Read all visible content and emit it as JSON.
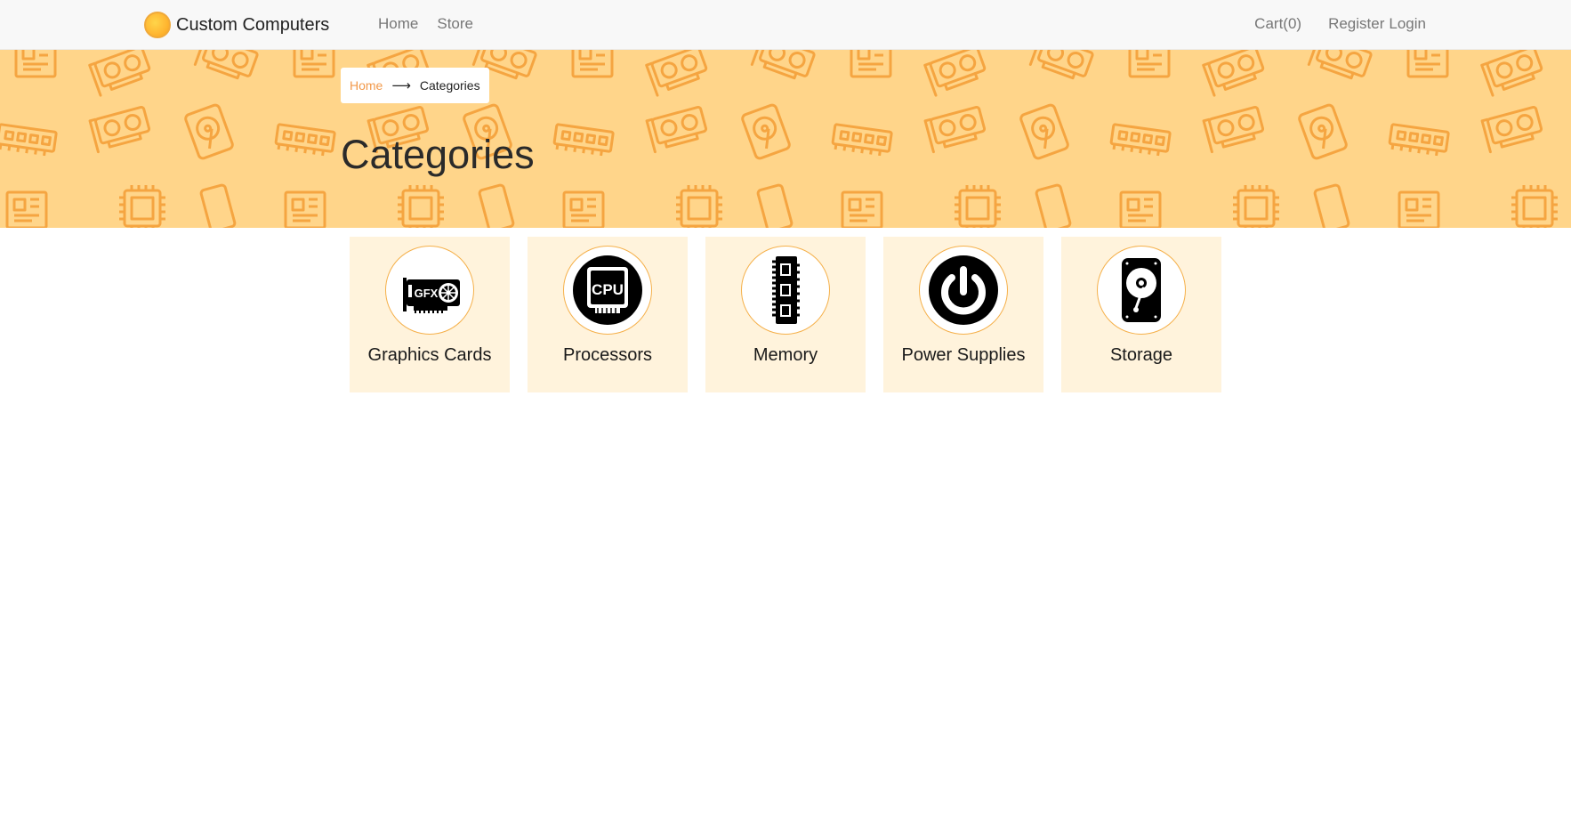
{
  "navbar": {
    "brand": "Custom Computers",
    "logo_icon": "orange-circle-logo-icon",
    "left_links": [
      {
        "label": "Home"
      },
      {
        "label": "Store"
      }
    ],
    "right_links": [
      {
        "label": "Cart(0)"
      },
      {
        "label": "Register"
      },
      {
        "label": "Login"
      }
    ]
  },
  "hero": {
    "background_color": "#ffd58a",
    "pattern_color": "#f5a541",
    "breadcrumb": {
      "home": "Home",
      "separator": "⟶",
      "current": "Categories"
    },
    "title": "Categories"
  },
  "categories": [
    {
      "label": "Graphics Cards",
      "icon": "graphics-card-icon"
    },
    {
      "label": "Processors",
      "icon": "cpu-icon"
    },
    {
      "label": "Memory",
      "icon": "memory-ram-icon"
    },
    {
      "label": "Power Supplies",
      "icon": "power-icon"
    },
    {
      "label": "Storage",
      "icon": "hard-drive-icon"
    }
  ],
  "colors": {
    "accent": "#f2994a",
    "card_background": "#fff3dc",
    "navbar_background": "#f8f8f8"
  }
}
